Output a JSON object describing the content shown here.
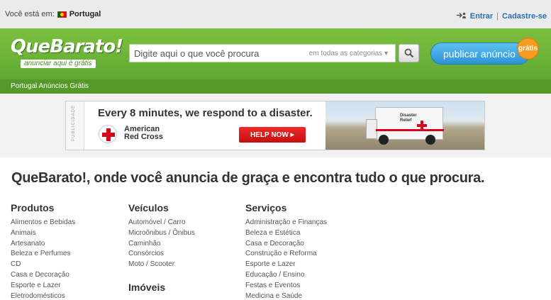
{
  "topbar": {
    "location_label": "Você está em:",
    "country": "Portugal",
    "login": "Entrar",
    "separator": "|",
    "signup": "Cadastre-se"
  },
  "header": {
    "logo_name": "QueBarato!",
    "logo_tagline": "anunciar aqui é grátis",
    "search_placeholder": "Digite aqui o que você procura",
    "category_select": "em todas as categorias",
    "publish_button": "publicar anúncio",
    "free_badge": "grátis"
  },
  "subnav": {
    "label": "Portugal Anúncios Grátis"
  },
  "ad": {
    "side_label": "PUBLICIDADE",
    "headline": "Every 8 minutes, we respond to a disaster.",
    "org_line1": "American",
    "org_line2": "Red Cross",
    "cta": "HELP NOW",
    "truck_label_1": "Disaster",
    "truck_label_2": "Relief"
  },
  "main": {
    "headline": "QueBarato!, onde você anuncia de graça e encontra tudo o que procura.",
    "columns": [
      {
        "title": "Produtos",
        "items": [
          "Alimentos e Bebidas",
          "Animais",
          "Artesanato",
          "Beleza e Perfumes",
          "CD",
          "Casa e Decoração",
          "Esporte e Lazer",
          "Eletrodomésticos"
        ]
      },
      {
        "title": "Veículos",
        "items": [
          "Automóvel / Carro",
          "Microônibus / Ônibus",
          "Caminhão",
          "Consórcios",
          "Moto / Scooter"
        ],
        "second_title": "Imóveis"
      },
      {
        "title": "Serviços",
        "items": [
          "Administração e Finanças",
          "Beleza e Estética",
          "Casa e Decoração",
          "Construção e Reforma",
          "Esporte e Lazer",
          "Educação / Ensino",
          "Festas e Eventos",
          "Medicina e Saúde"
        ]
      }
    ]
  },
  "colors": {
    "header_green": "#6ab437",
    "link_blue": "#2a6db4",
    "publish_blue": "#2b93d8",
    "badge_orange": "#f39c1f"
  }
}
